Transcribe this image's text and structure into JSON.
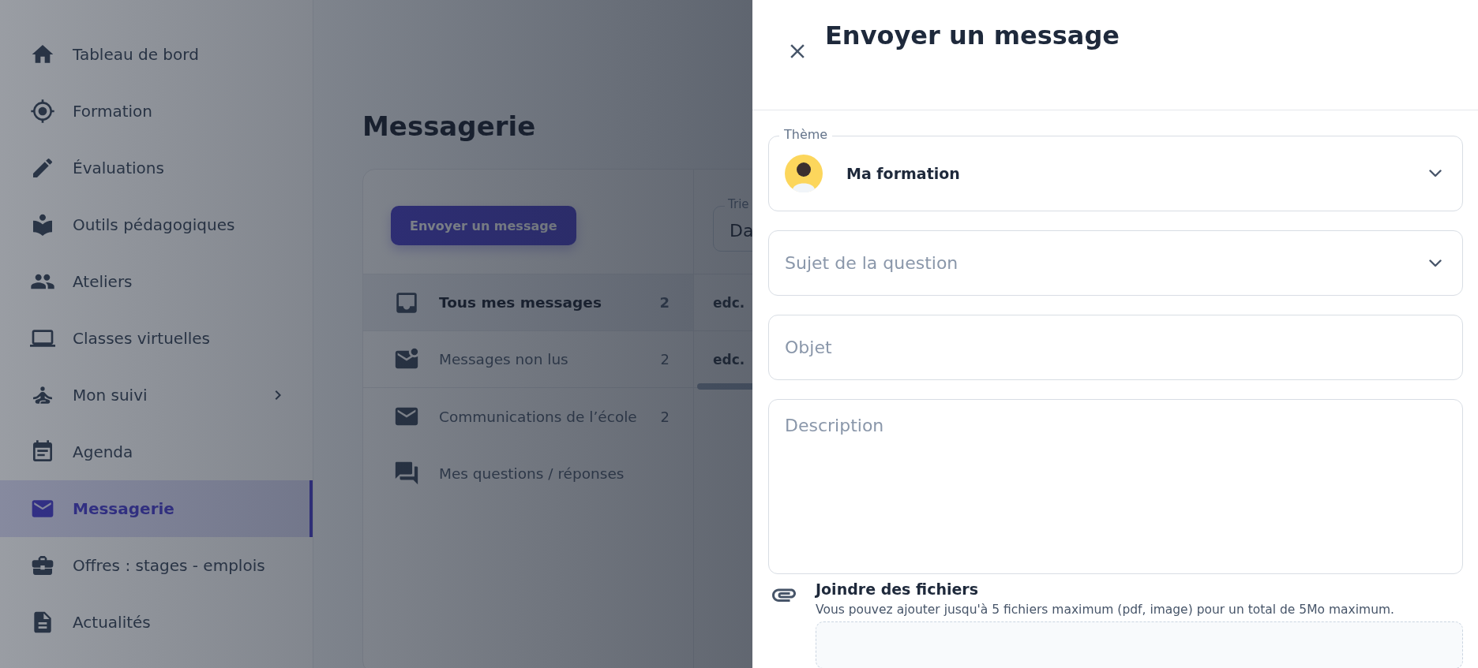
{
  "sidebar": {
    "items": [
      {
        "label": "Tableau de bord",
        "selected": false,
        "expandable": false
      },
      {
        "label": "Formation",
        "selected": false,
        "expandable": false
      },
      {
        "label": "Évaluations",
        "selected": false,
        "expandable": false
      },
      {
        "label": "Outils pédagogiques",
        "selected": false,
        "expandable": false
      },
      {
        "label": "Ateliers",
        "selected": false,
        "expandable": false
      },
      {
        "label": "Classes virtuelles",
        "selected": false,
        "expandable": false
      },
      {
        "label": "Mon suivi",
        "selected": false,
        "expandable": true
      },
      {
        "label": "Agenda",
        "selected": false,
        "expandable": false
      },
      {
        "label": "Messagerie",
        "selected": true,
        "expandable": false
      },
      {
        "label": "Offres : stages - emplois",
        "selected": false,
        "expandable": false
      },
      {
        "label": "Actualités",
        "selected": false,
        "expandable": false
      }
    ]
  },
  "main": {
    "title": "Messagerie",
    "compose_button": "Envoyer un message",
    "folders": [
      {
        "label": "Tous mes messages",
        "count": "2",
        "selected": true
      },
      {
        "label": "Messages non lus",
        "count": "2",
        "selected": false
      },
      {
        "label": "Communications de l’école",
        "count": "2",
        "selected": false
      },
      {
        "label": "Mes questions / réponses",
        "selected": false
      }
    ],
    "sort_field": {
      "label": "Trie",
      "value": "Da"
    },
    "messages": [
      {
        "sender": "edc."
      },
      {
        "sender": "edc."
      }
    ]
  },
  "drawer": {
    "title": "Envoyer un message",
    "fields": [
      {
        "kind": "select",
        "label": "Thème",
        "value": "Ma formation"
      },
      {
        "kind": "select",
        "placeholder": "Sujet de la question"
      },
      {
        "kind": "text",
        "placeholder": "Objet"
      },
      {
        "kind": "textarea",
        "placeholder": "Description"
      }
    ],
    "attachments": {
      "title": "Joindre des fichiers",
      "hint": "Vous pouvez ajouter jusqu'à 5 fichiers maximum (pdf, image) pour un total de 5Mo maximum."
    }
  }
}
